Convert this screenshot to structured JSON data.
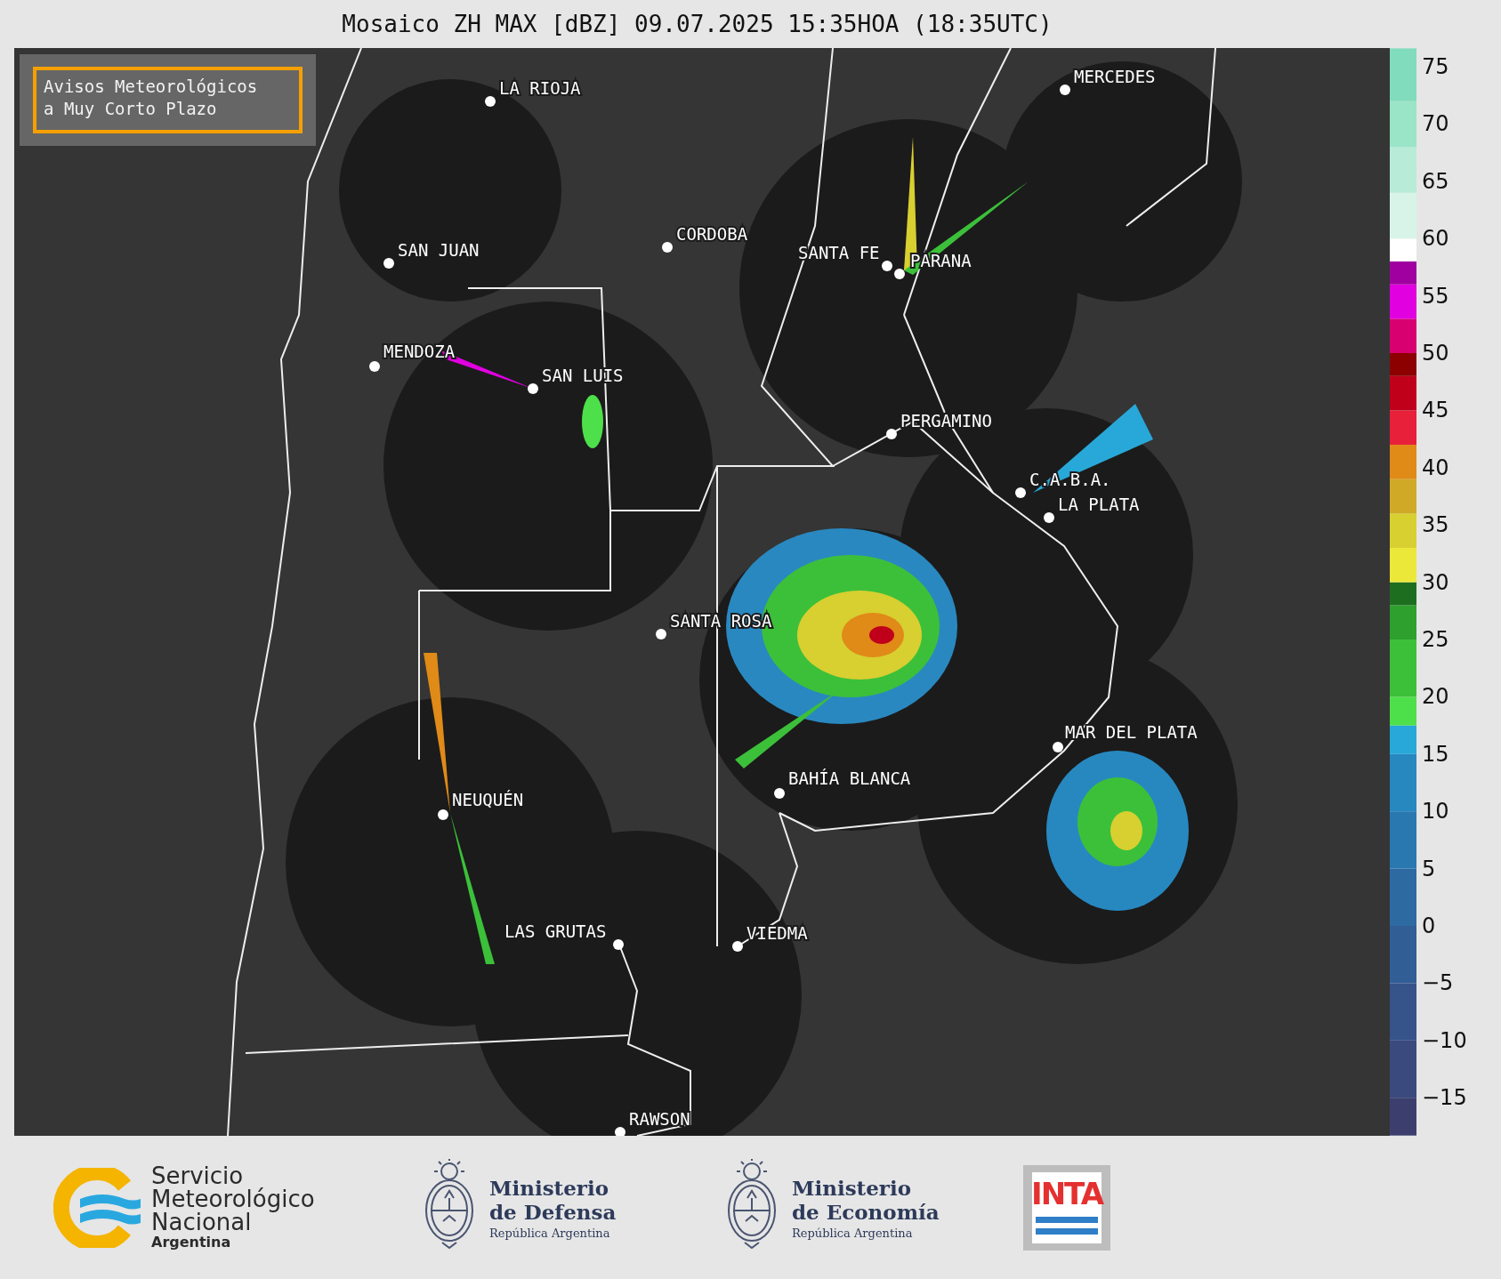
{
  "title": "Mosaico ZH MAX [dBZ] 09.07.2025 15:35HOA (18:35UTC)",
  "notice": {
    "lines": [
      "Avisos Meteorológicos",
      "a Muy Corto Plazo"
    ]
  },
  "cities": [
    {
      "name": "LA RIOJA"
    },
    {
      "name": "SAN JUAN"
    },
    {
      "name": "CORDOBA"
    },
    {
      "name": "SANTA FE"
    },
    {
      "name": "PARANA"
    },
    {
      "name": "MERCEDES"
    },
    {
      "name": "MENDOZA"
    },
    {
      "name": "SAN LUIS"
    },
    {
      "name": "PERGAMINO"
    },
    {
      "name": "C.A.B.A."
    },
    {
      "name": "LA PLATA"
    },
    {
      "name": "SANTA ROSA"
    },
    {
      "name": "MAR DEL PLATA"
    },
    {
      "name": "BAHÍA BLANCA"
    },
    {
      "name": "NEUQUÉN"
    },
    {
      "name": "LAS GRUTAS"
    },
    {
      "name": "VIEDMA"
    },
    {
      "name": "RAWSON"
    }
  ],
  "colorbar": {
    "ticks": [
      "75",
      "70",
      "65",
      "60",
      "55",
      "50",
      "45",
      "40",
      "35",
      "30",
      "25",
      "20",
      "15",
      "10",
      "5",
      "0",
      "−5",
      "−10",
      "−15"
    ]
  },
  "footer": {
    "smn": {
      "lines": [
        "Servicio",
        "Meteorológico",
        "Nacional"
      ],
      "country": "Argentina"
    },
    "ministries": [
      {
        "lines": [
          "Ministerio",
          "de Defensa"
        ],
        "country": "República Argentina"
      },
      {
        "lines": [
          "Ministerio",
          "de Economía"
        ],
        "country": "República Argentina"
      }
    ],
    "inta": "INTA"
  }
}
